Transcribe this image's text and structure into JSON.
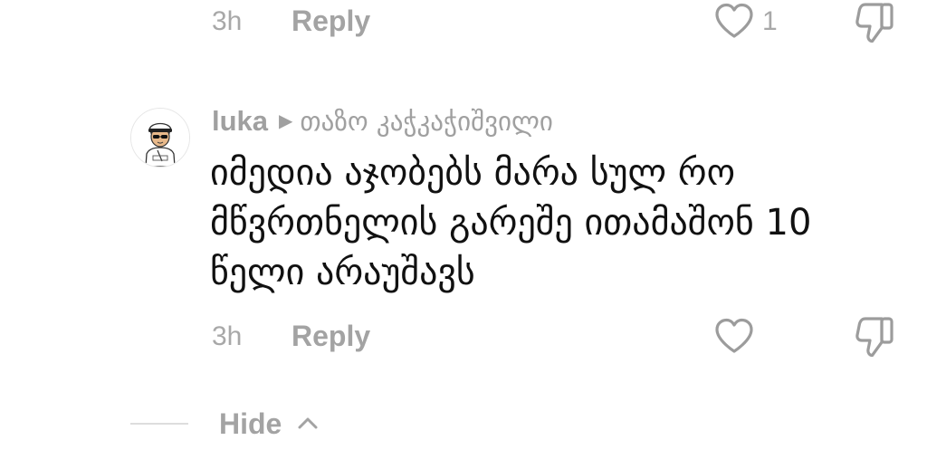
{
  "previous_comment": {
    "time": "3h",
    "reply_label": "Reply",
    "like_count": "1",
    "like_icon": "heart-outline-icon",
    "dislike_icon": "thumbs-down-icon"
  },
  "comment": {
    "author": "luka",
    "reply_to": "თაზო კაჭკაჭიშვილი",
    "text": "იმედია აჯობებს მარა სულ რო მწვრთნელის გარეშე ითამაშონ 10 წელი არაუშავს",
    "time": "3h",
    "reply_label": "Reply",
    "like_icon": "heart-outline-icon",
    "dislike_icon": "thumbs-down-icon"
  },
  "thread": {
    "hide_label": "Hide",
    "hide_icon": "chevron-up-icon"
  },
  "colors": {
    "text": "#111111",
    "muted": "#a3a3a3",
    "icon": "#9c9c9c",
    "divider": "#dddddd"
  }
}
